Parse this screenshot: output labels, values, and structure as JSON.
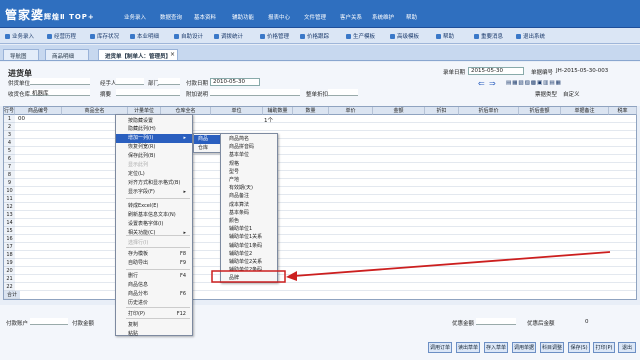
{
  "app": {
    "logo": "管家婆",
    "logo_sub": "辉煌Ⅱ TOP+",
    "menus": [
      "业务录入",
      "数据查询",
      "基本资料",
      "辅助功能",
      "报表中心",
      "文件管理",
      "客户关系",
      "系统维护",
      "帮助"
    ]
  },
  "toolbar": [
    "业务录入",
    "经营历程",
    "库存状况",
    "本业明细",
    "自助设计",
    "调拨统计",
    "价格管理",
    "价格跟踪",
    "生产模板",
    "高级模板",
    "帮助",
    "重要消息",
    "退出系统"
  ],
  "tabs": [
    "导航图",
    "商品明细",
    "进货单【制单人：管理员】"
  ],
  "form": {
    "title": "进货单",
    "order_date_label": "录单日期",
    "order_date": "2015-05-30",
    "order_no_label": "单据编号",
    "order_no": "JH-2015-05-30-003",
    "supplier_label": "供货单位",
    "handler_label": "经手人",
    "dept_label": "部门",
    "pay_date_label": "付款日期",
    "pay_date": "2010-05-30",
    "warehouse_label": "收货仓库",
    "warehouse": "机器库",
    "summary_label": "摘要",
    "attach_label": "附加说明",
    "discount_label": "整单折扣",
    "pay_type_label": "票据类型",
    "pay_type": "自定义"
  },
  "grid": {
    "headers": [
      "行号",
      "商品编号",
      "商品全名",
      "计量单位",
      "仓库全名",
      "单位",
      "辅助数量",
      "数量",
      "单价",
      "金额",
      "折扣",
      "折后单价",
      "折后金额",
      "单据备注",
      "税率"
    ],
    "row1_code": "00",
    "rows": [
      "1",
      "2",
      "3",
      "4",
      "5",
      "6",
      "7",
      "8",
      "9",
      "10",
      "11",
      "12",
      "13",
      "14",
      "15",
      "16",
      "17",
      "18",
      "19",
      "20",
      "21",
      "22"
    ],
    "total": "合计"
  },
  "context_menu": [
    "按隐藏设置",
    "隐藏此列(H)",
    "增加一列(I)",
    "恢复列宽(R)",
    "保存此列(B)",
    "显示此列",
    "定位(L)",
    "对齐方式和显示格式(B)",
    "显示字段(F)",
    "转成Excel(E)",
    "刷新基本信息文本(N)",
    "设置表格字体(I)",
    "相关功能(C)",
    "选择行(I)",
    "存为模板",
    "自助导出",
    "删行",
    "商品信息",
    "商品分布",
    "历史进价",
    "打印(P)",
    "复制",
    "粘贴"
  ],
  "context_keys": {
    "存为模板": "F8",
    "自助导出": "F9",
    "删行": "F4",
    "商品分布": "F6",
    "打印(P)": "F12"
  },
  "submenu1": [
    "商品",
    "仓库"
  ],
  "submenu2": [
    "商品简名",
    "商品拼音码",
    "基本单位",
    "规格",
    "型号",
    "产地",
    "有效期(天)",
    "商品备注",
    "成本算法",
    "基本条码",
    "颜色",
    "辅助单位1",
    "辅助单位1关系",
    "辅助单位1条码",
    "辅助单位2",
    "辅助单位2关系",
    "辅助单位2条码",
    "品牌"
  ],
  "footer": {
    "pay_account_label": "付款账户",
    "pay_amount_label": "付款金额",
    "discount_amount_label": "优惠金额",
    "discount_value_label": "优惠后金额",
    "discount_value": "0"
  },
  "buttons": [
    "调用订单",
    "读出草单",
    "存入草单",
    "调用单据",
    "科目调整",
    "保存(S)",
    "打印(P)",
    "退出"
  ],
  "colors": {
    "accent": "#2f6fbf",
    "highlight": "#2a5fbf",
    "arrow": "#cc1f1f"
  }
}
